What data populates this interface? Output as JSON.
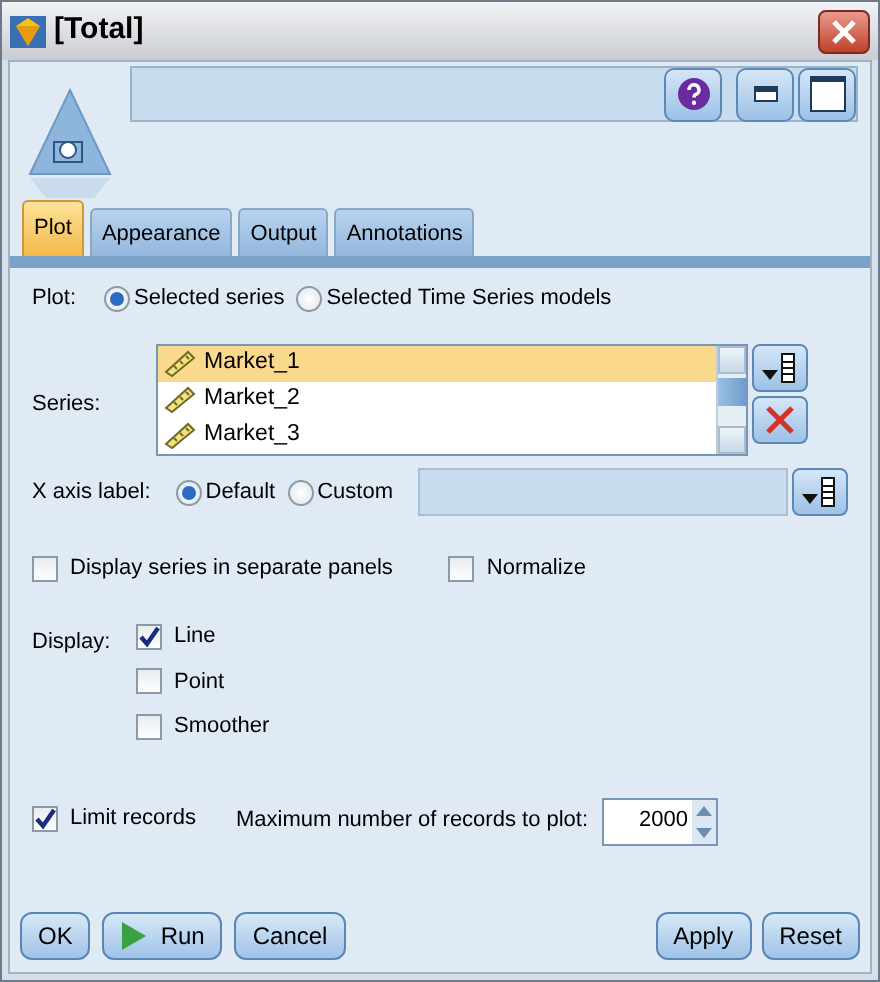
{
  "window": {
    "title": "[Total]"
  },
  "tabs": [
    {
      "label": "Plot",
      "selected": true
    },
    {
      "label": "Appearance",
      "selected": false
    },
    {
      "label": "Output",
      "selected": false
    },
    {
      "label": "Annotations",
      "selected": false
    }
  ],
  "plot": {
    "label": "Plot:",
    "options": [
      {
        "label": "Selected series",
        "selected": true
      },
      {
        "label": "Selected Time Series models",
        "selected": false
      }
    ]
  },
  "series": {
    "label": "Series:",
    "items": [
      {
        "name": "Market_1",
        "selected": true
      },
      {
        "name": "Market_2",
        "selected": false
      },
      {
        "name": "Market_3",
        "selected": false
      }
    ]
  },
  "x_axis": {
    "label": "X axis label:",
    "options": [
      {
        "label": "Default",
        "selected": true
      },
      {
        "label": "Custom",
        "selected": false
      }
    ]
  },
  "flags": [
    {
      "label": "Display series in separate panels",
      "checked": false
    },
    {
      "label": "Normalize",
      "checked": false
    }
  ],
  "display": {
    "label": "Display:",
    "options": [
      {
        "label": "Line",
        "checked": true
      },
      {
        "label": "Point",
        "checked": false
      },
      {
        "label": "Smoother",
        "checked": false
      }
    ]
  },
  "limit": {
    "label": "Limit records",
    "checked": true,
    "max_label": "Maximum number of records to plot:",
    "value": "2000"
  },
  "buttons_left": [
    {
      "label": "OK",
      "kind": "plain"
    },
    {
      "label": "Run",
      "kind": "run"
    },
    {
      "label": "Cancel",
      "kind": "plain"
    }
  ],
  "buttons_right": [
    {
      "label": "Apply",
      "kind": "plain"
    },
    {
      "label": "Reset",
      "kind": "plain"
    }
  ]
}
